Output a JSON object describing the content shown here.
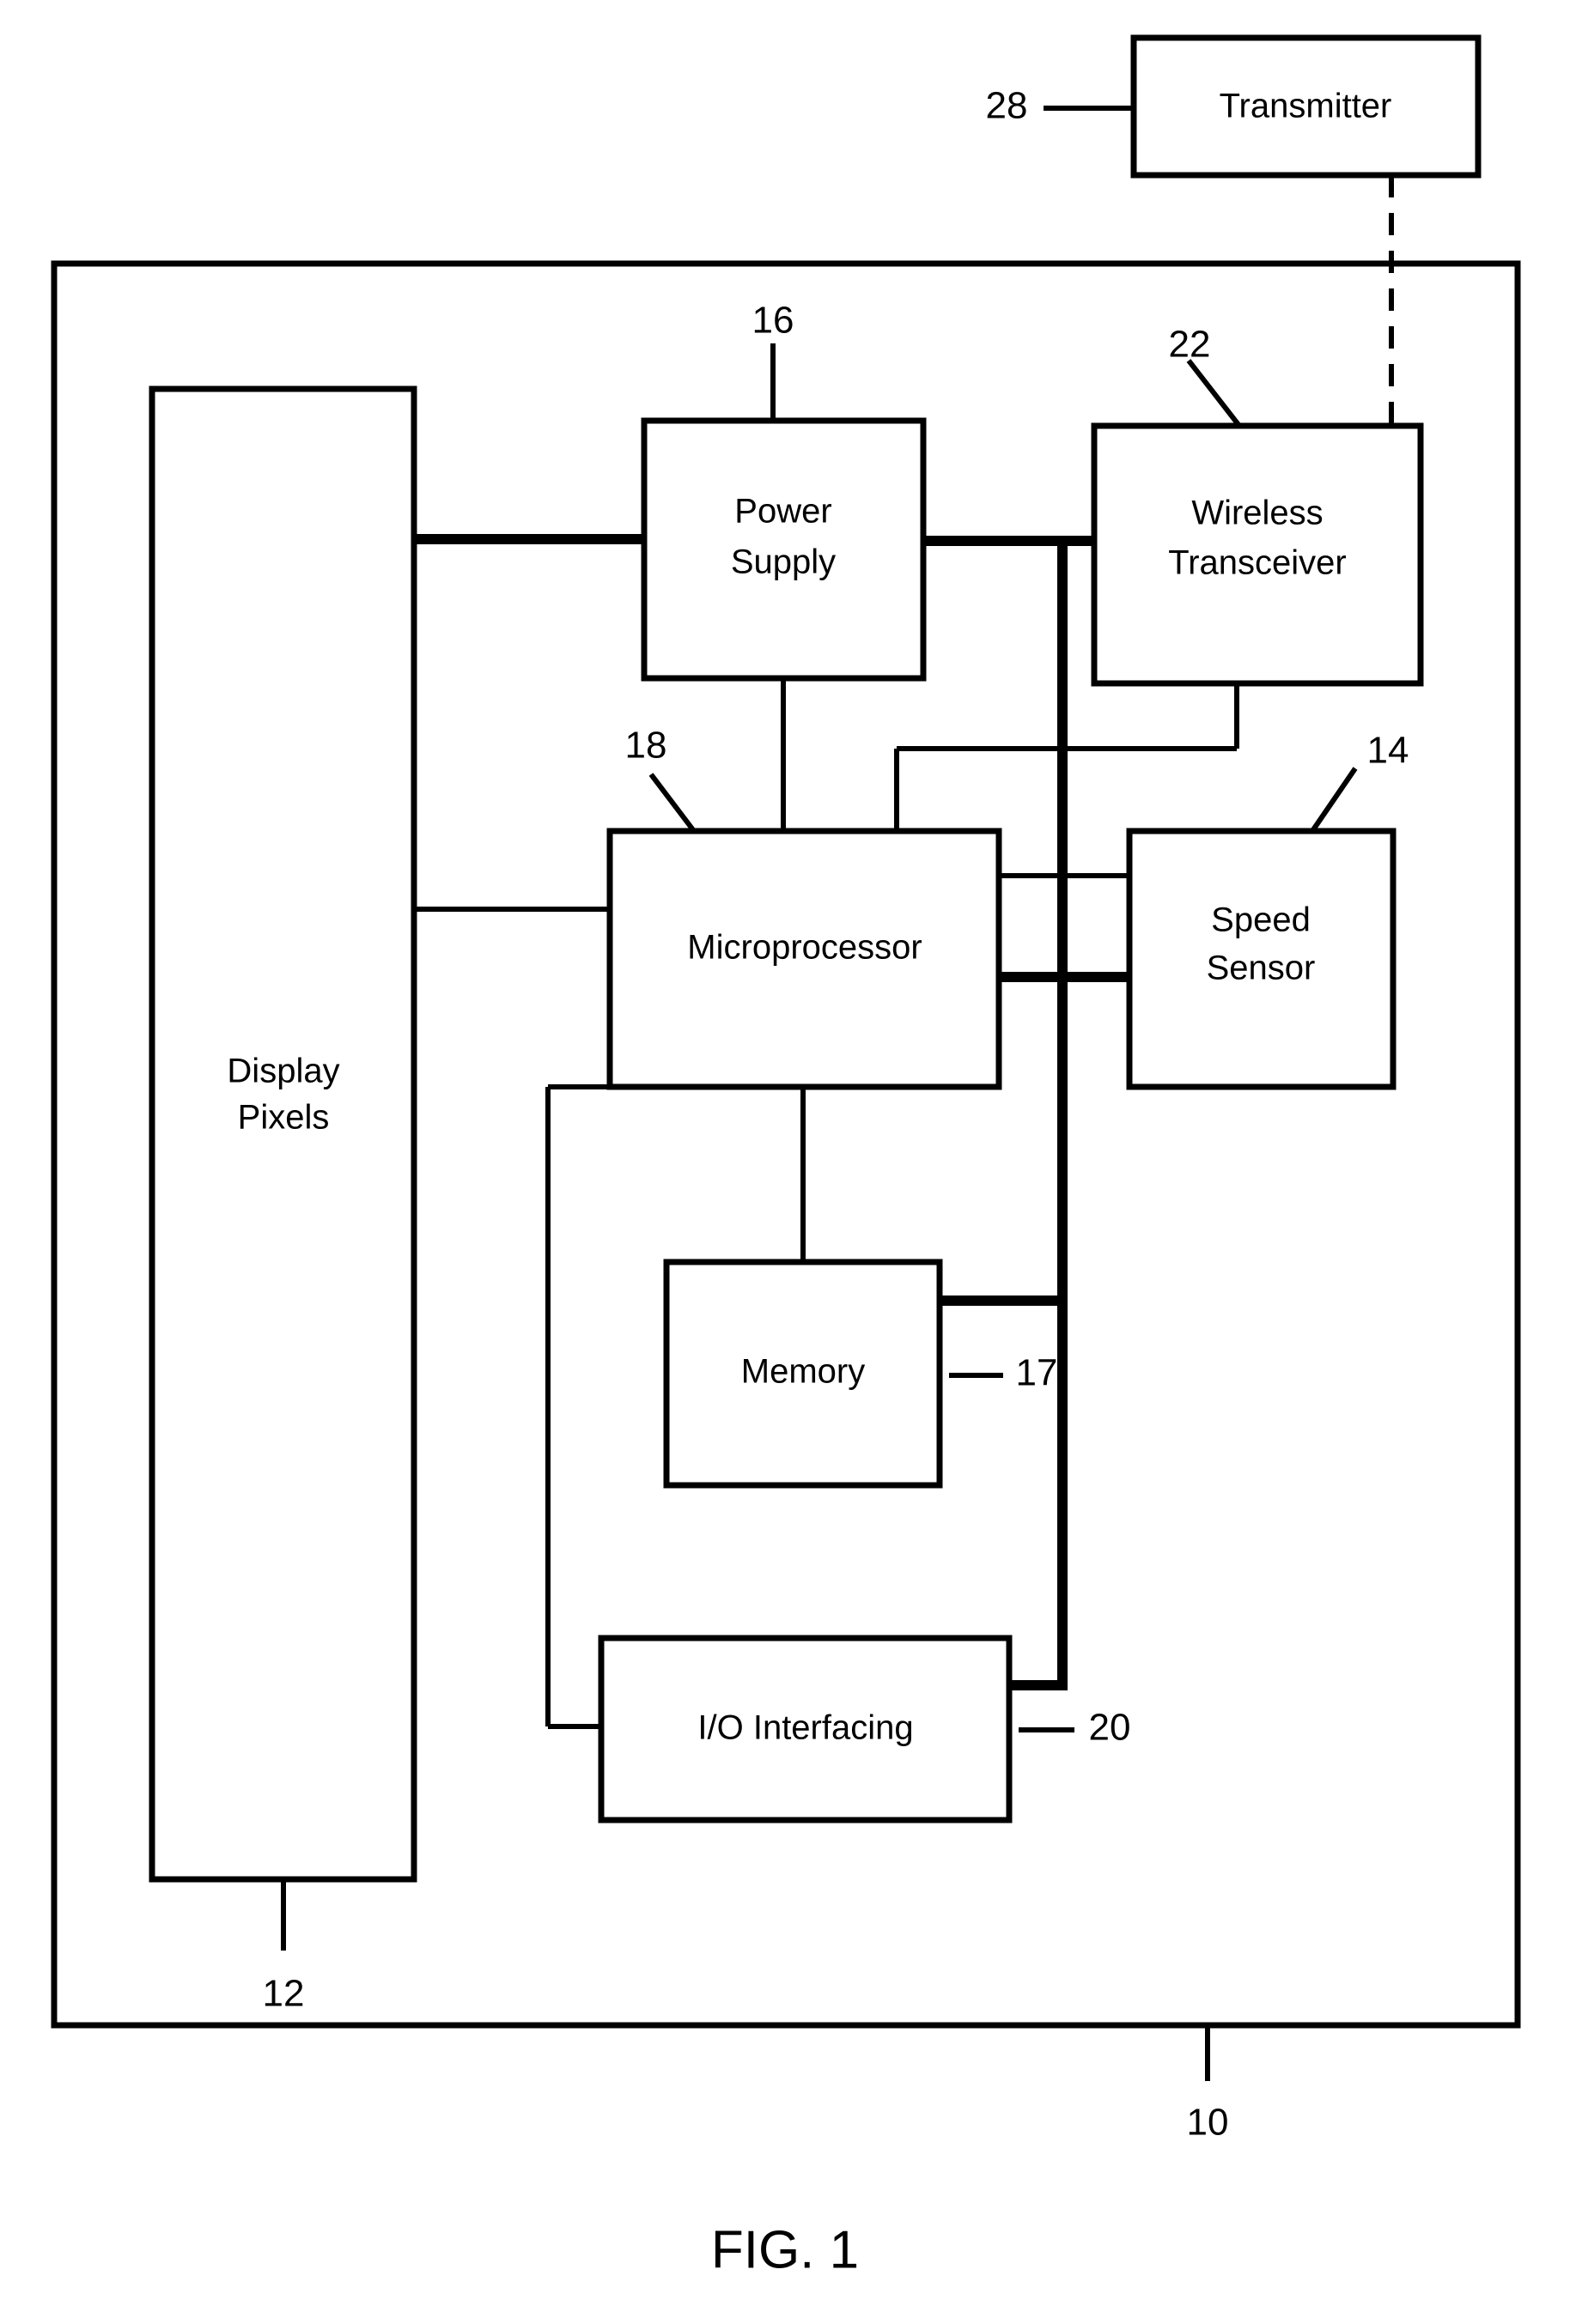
{
  "figure": {
    "caption": "FIG. 1",
    "system_ref": "10",
    "blocks": [
      {
        "id": "transmitter",
        "label": "Transmitter",
        "ref": "28",
        "line2": ""
      },
      {
        "id": "power-supply",
        "label": "Power",
        "ref": "16",
        "line2": "Supply"
      },
      {
        "id": "wireless",
        "label": "Wireless",
        "ref": "22",
        "line2": "Transceiver"
      },
      {
        "id": "display",
        "label": "Display",
        "ref": "12",
        "line2": "Pixels"
      },
      {
        "id": "microprocessor",
        "label": "Microprocessor",
        "ref": "18",
        "line2": ""
      },
      {
        "id": "speed-sensor",
        "label": "Speed",
        "ref": "14",
        "line2": "Sensor"
      },
      {
        "id": "memory",
        "label": "Memory",
        "ref": "17",
        "line2": ""
      },
      {
        "id": "io",
        "label": "I/O Interfacing",
        "ref": "20",
        "line2": ""
      }
    ]
  },
  "labels": {
    "transmitter": "Transmitter",
    "power_supply_1": "Power",
    "power_supply_2": "Supply",
    "wireless_1": "Wireless",
    "wireless_2": "Transceiver",
    "display_1": "Display",
    "display_2": "Pixels",
    "microprocessor": "Microprocessor",
    "speed_1": "Speed",
    "speed_2": "Sensor",
    "memory": "Memory",
    "io": "I/O Interfacing"
  },
  "refs": {
    "transmitter": "28",
    "power_supply": "16",
    "wireless": "22",
    "display": "12",
    "microprocessor": "18",
    "speed_sensor": "14",
    "memory": "17",
    "io": "20",
    "system": "10"
  },
  "caption": "FIG. 1",
  "colors": {
    "ink": "#000000",
    "paper": "#ffffff"
  }
}
